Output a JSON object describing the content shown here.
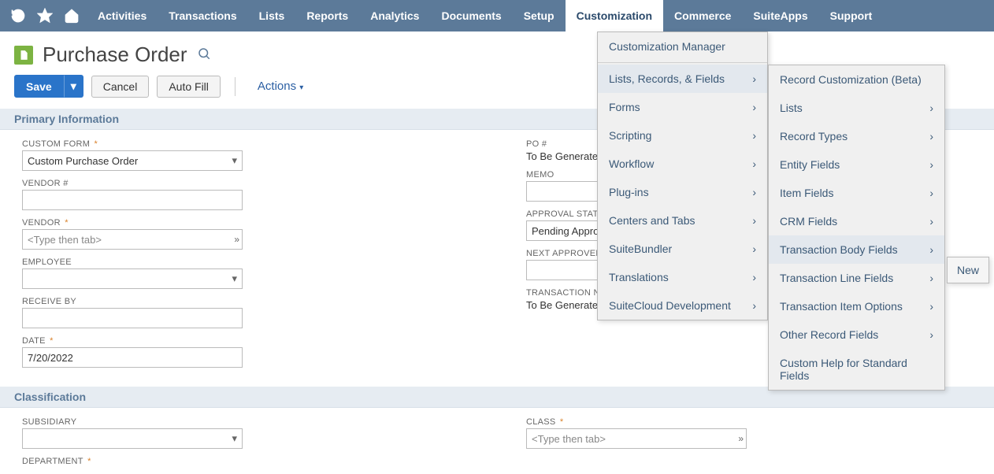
{
  "topnav": {
    "items": [
      "Activities",
      "Transactions",
      "Lists",
      "Reports",
      "Analytics",
      "Documents",
      "Setup",
      "Customization",
      "Commerce",
      "SuiteApps",
      "Support"
    ],
    "active": "Customization"
  },
  "menus": {
    "customization": [
      {
        "label": "Customization Manager",
        "submenu": false
      },
      {
        "label": "Lists, Records, & Fields",
        "submenu": true,
        "hover": true
      },
      {
        "label": "Forms",
        "submenu": true
      },
      {
        "label": "Scripting",
        "submenu": true
      },
      {
        "label": "Workflow",
        "submenu": true
      },
      {
        "label": "Plug-ins",
        "submenu": true
      },
      {
        "label": "Centers and Tabs",
        "submenu": true
      },
      {
        "label": "SuiteBundler",
        "submenu": true
      },
      {
        "label": "Translations",
        "submenu": true
      },
      {
        "label": "SuiteCloud Development",
        "submenu": true
      }
    ],
    "lists_records_fields": [
      {
        "label": "Record Customization (Beta)",
        "submenu": false
      },
      {
        "label": "Lists",
        "submenu": true
      },
      {
        "label": "Record Types",
        "submenu": true
      },
      {
        "label": "Entity Fields",
        "submenu": true
      },
      {
        "label": "Item Fields",
        "submenu": true
      },
      {
        "label": "CRM Fields",
        "submenu": true
      },
      {
        "label": "Transaction Body Fields",
        "submenu": true,
        "hover": true
      },
      {
        "label": "Transaction Line Fields",
        "submenu": true
      },
      {
        "label": "Transaction Item Options",
        "submenu": true
      },
      {
        "label": "Other Record Fields",
        "submenu": true
      },
      {
        "label": "Custom Help for Standard Fields",
        "submenu": false
      }
    ],
    "flyout_new": "New"
  },
  "page": {
    "title": "Purchase Order"
  },
  "buttons": {
    "save": "Save",
    "cancel": "Cancel",
    "autofill": "Auto Fill",
    "actions": "Actions"
  },
  "sections": {
    "primary": "Primary Information",
    "classification": "Classification"
  },
  "fields": {
    "custom_form": {
      "label": "CUSTOM FORM",
      "value": "Custom Purchase Order",
      "required": true
    },
    "vendor_num": {
      "label": "VENDOR #",
      "value": ""
    },
    "vendor": {
      "label": "VENDOR",
      "placeholder": "<Type then tab>",
      "required": true
    },
    "employee": {
      "label": "EMPLOYEE",
      "value": ""
    },
    "receive_by": {
      "label": "RECEIVE BY",
      "value": ""
    },
    "date": {
      "label": "DATE",
      "value": "7/20/2022",
      "required": true
    },
    "po_num": {
      "label": "PO #",
      "value": "To Be Generated"
    },
    "memo": {
      "label": "MEMO",
      "value": ""
    },
    "approval_status": {
      "label": "APPROVAL STATUS",
      "value": "Pending Approval"
    },
    "next_approver": {
      "label": "NEXT APPROVER",
      "value": ""
    },
    "transaction_number": {
      "label": "TRANSACTION NUMBE",
      "value": "To Be Generated"
    },
    "subsidiary": {
      "label": "SUBSIDIARY",
      "value": ""
    },
    "department": {
      "label": "DEPARTMENT",
      "required": true
    },
    "class": {
      "label": "CLASS",
      "placeholder": "<Type then tab>",
      "required": true
    }
  }
}
